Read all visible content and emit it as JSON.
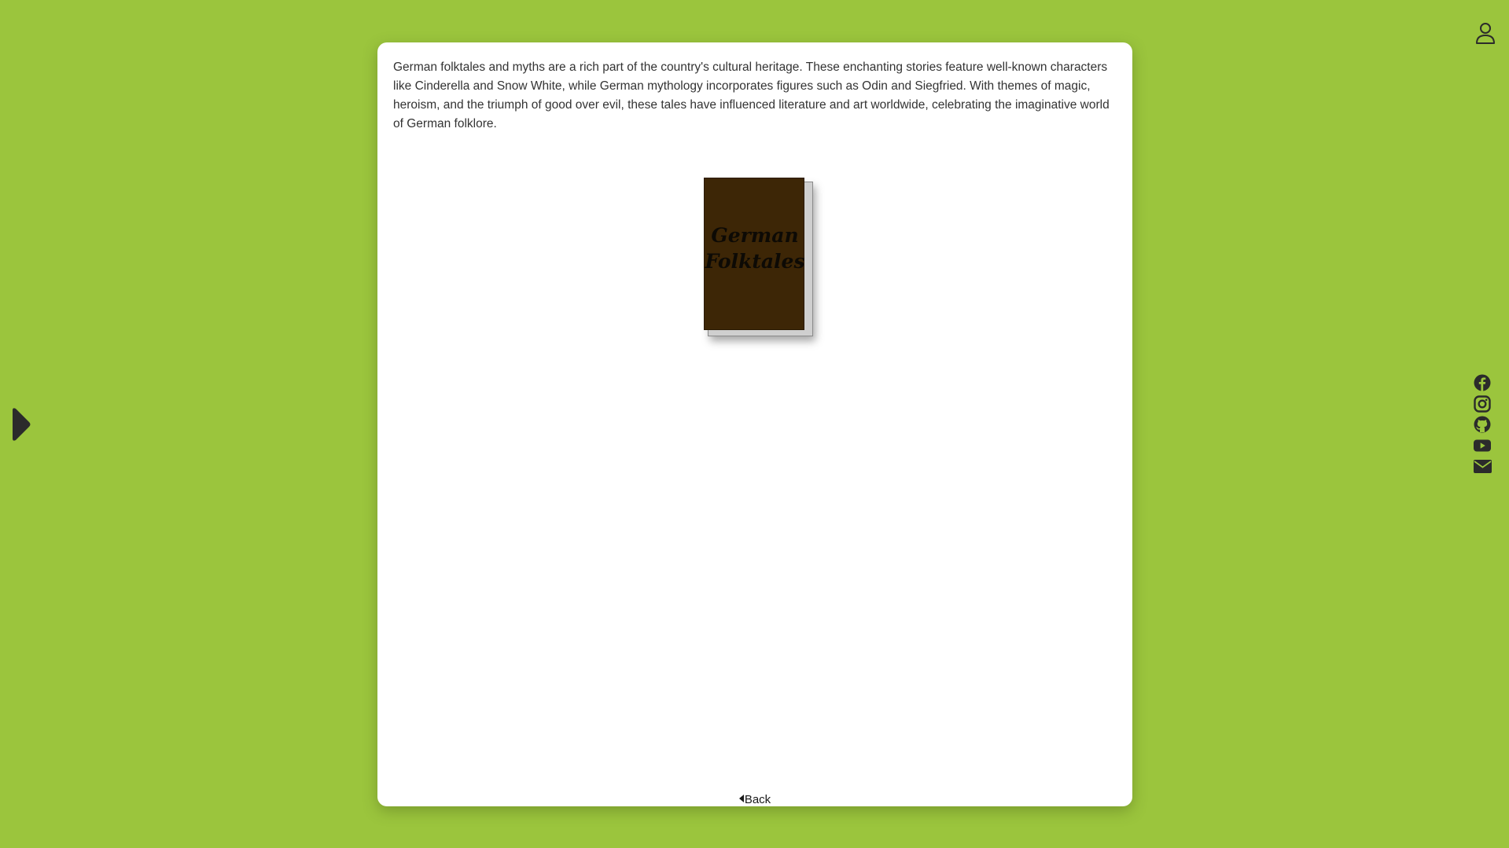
{
  "main": {
    "intro_text": "German folktales and myths are a rich part of the country's cultural heritage. These enchanting stories feature well-known characters like Cinderella and Snow White, while German mythology incorporates figures such as Odin and Siegfried. With themes of magic, heroism, and the triumph of good over evil, these tales have influenced literature and art worldwide, celebrating the imaginative world of German folklore.",
    "book": {
      "title_line1": "German",
      "title_line2": "Folktales",
      "cover_color": "#3d2606"
    },
    "back_label": "Back"
  },
  "colors": {
    "background": "#9bc53d",
    "card": "#ffffff",
    "icon": "#2b2b2b"
  },
  "icons": {
    "user": "user-icon",
    "nav": "play-arrow-icon",
    "social": [
      "facebook-icon",
      "instagram-icon",
      "github-icon",
      "youtube-icon",
      "email-icon"
    ]
  }
}
